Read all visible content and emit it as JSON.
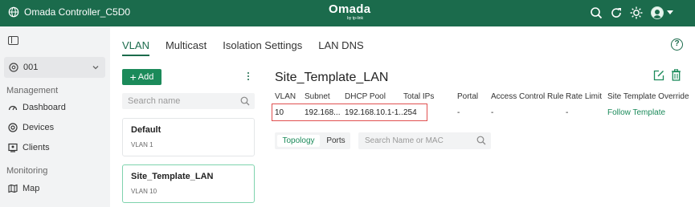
{
  "topbar": {
    "controller_name": "Omada Controller_C5D0",
    "brand": "Omada",
    "brand_sub": "by tp-link",
    "icons": [
      "search-icon",
      "refresh-icon",
      "theme-icon",
      "user-avatar-icon",
      "chevron-down-icon"
    ]
  },
  "sidebar": {
    "site": "001",
    "sections": [
      {
        "label": "Management",
        "items": [
          {
            "label": "Dashboard",
            "icon": "dashboard-icon"
          },
          {
            "label": "Devices",
            "icon": "devices-icon"
          },
          {
            "label": "Clients",
            "icon": "clients-icon"
          }
        ]
      },
      {
        "label": "Monitoring",
        "items": [
          {
            "label": "Map",
            "icon": "map-icon"
          }
        ]
      }
    ]
  },
  "tabs": [
    "VLAN",
    "Multicast",
    "Isolation Settings",
    "LAN DNS"
  ],
  "active_tab": "VLAN",
  "vlan_list": {
    "add_label": "Add",
    "search_placeholder": "Search name",
    "items": [
      {
        "name": "Default",
        "sub": "VLAN 1"
      },
      {
        "name": "Site_Template_LAN",
        "sub": "VLAN 10"
      }
    ]
  },
  "detail": {
    "title": "Site_Template_LAN",
    "headers": [
      "VLAN",
      "Subnet",
      "DHCP Pool",
      "Total IPs",
      "Portal",
      "Access Control Rule",
      "Rate Limit",
      "Site Template Override"
    ],
    "row": [
      "10",
      "192.168...",
      "192.168.10.1-1...",
      "254",
      "-",
      "-",
      "-",
      "Follow Template"
    ],
    "segments": [
      "Topology",
      "Ports"
    ],
    "search_placeholder": "Search Name or MAC"
  },
  "colors": {
    "brand": "#1b6b4c",
    "accent": "#1b8a5a",
    "highlight": "#e05050"
  }
}
